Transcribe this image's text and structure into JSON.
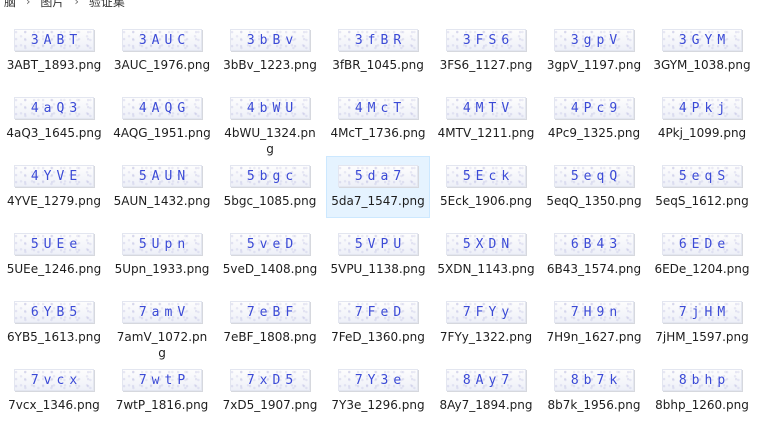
{
  "breadcrumb": {
    "items": [
      "脑",
      "图片",
      "验证集"
    ]
  },
  "files": [
    {
      "code": "3ABT",
      "name": "3ABT_1893.png"
    },
    {
      "code": "3AUC",
      "name": "3AUC_1976.png"
    },
    {
      "code": "3bBv",
      "name": "3bBv_1223.png"
    },
    {
      "code": "3fBR",
      "name": "3fBR_1045.png"
    },
    {
      "code": "3FS6",
      "name": "3FS6_1127.png"
    },
    {
      "code": "3gpV",
      "name": "3gpV_1197.png"
    },
    {
      "code": "3GYM",
      "name": "3GYM_1038.png"
    },
    {
      "code": "4aQ3",
      "name": "4aQ3_1645.png"
    },
    {
      "code": "4AQG",
      "name": "4AQG_1951.png"
    },
    {
      "code": "4bWU",
      "name": "4bWU_1324.png"
    },
    {
      "code": "4McT",
      "name": "4McT_1736.png"
    },
    {
      "code": "4MTV",
      "name": "4MTV_1211.png"
    },
    {
      "code": "4Pc9",
      "name": "4Pc9_1325.png"
    },
    {
      "code": "4Pkj",
      "name": "4Pkj_1099.png"
    },
    {
      "code": "4YVE",
      "name": "4YVE_1279.png"
    },
    {
      "code": "5AUN",
      "name": "5AUN_1432.png"
    },
    {
      "code": "5bgc",
      "name": "5bgc_1085.png"
    },
    {
      "code": "5da7",
      "name": "5da7_1547.png",
      "selected": true
    },
    {
      "code": "5Eck",
      "name": "5Eck_1906.png"
    },
    {
      "code": "5eqQ",
      "name": "5eqQ_1350.png"
    },
    {
      "code": "5eqS",
      "name": "5eqS_1612.png"
    },
    {
      "code": "5UEe",
      "name": "5UEe_1246.png"
    },
    {
      "code": "5Upn",
      "name": "5Upn_1933.png"
    },
    {
      "code": "5veD",
      "name": "5veD_1408.png"
    },
    {
      "code": "5VPU",
      "name": "5VPU_1138.png"
    },
    {
      "code": "5XDN",
      "name": "5XDN_1143.png"
    },
    {
      "code": "6B43",
      "name": "6B43_1574.png"
    },
    {
      "code": "6EDe",
      "name": "6EDe_1204.png"
    },
    {
      "code": "6YB5",
      "name": "6YB5_1613.png"
    },
    {
      "code": "7amV",
      "name": "7amV_1072.png"
    },
    {
      "code": "7eBF",
      "name": "7eBF_1808.png"
    },
    {
      "code": "7FeD",
      "name": "7FeD_1360.png"
    },
    {
      "code": "7FYy",
      "name": "7FYy_1322.png"
    },
    {
      "code": "7H9n",
      "name": "7H9n_1627.png"
    },
    {
      "code": "7jHM",
      "name": "7jHM_1597.png"
    },
    {
      "code": "7vcx",
      "name": "7vcx_1346.png"
    },
    {
      "code": "7wtP",
      "name": "7wtP_1816.png"
    },
    {
      "code": "7xD5",
      "name": "7xD5_1907.png"
    },
    {
      "code": "7Y3e",
      "name": "7Y3e_1296.png"
    },
    {
      "code": "8Ay7",
      "name": "8Ay7_1894.png"
    },
    {
      "code": "8b7k",
      "name": "8b7k_1956.png"
    },
    {
      "code": "8bhp",
      "name": "8bhp_1260.png"
    }
  ],
  "colors": {
    "captcha_text": "#3b4ad6",
    "selection_bg": "#e5f3ff",
    "selection_border": "#cce8ff"
  }
}
